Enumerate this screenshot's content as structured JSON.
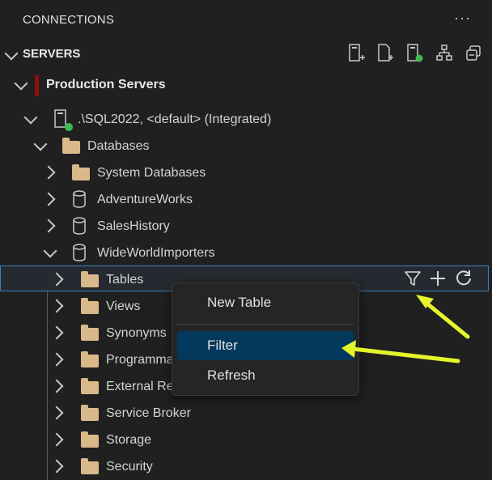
{
  "panel": {
    "title": "CONNECTIONS",
    "more_label": "···"
  },
  "servers_section": {
    "label": "SERVERS",
    "toolbar_icons": [
      "add-connection-icon",
      "new-query-icon",
      "server-connected-icon",
      "server-group-icon",
      "collapse-all-icon"
    ],
    "status_color": "#3fb950"
  },
  "tree": {
    "group": {
      "label": "Production Servers",
      "color": "#8b0f0f"
    },
    "server": {
      "label": ".\\SQL2022, <default> (Integrated)"
    },
    "databases": {
      "label": "Databases"
    },
    "items": [
      {
        "label": "System Databases"
      },
      {
        "label": "AdventureWorks"
      },
      {
        "label": "SalesHistory"
      },
      {
        "label": "WideWorldImporters"
      }
    ],
    "wwi_children": [
      {
        "label": "Tables"
      },
      {
        "label": "Views"
      },
      {
        "label": "Synonyms"
      },
      {
        "label": "Programmability"
      },
      {
        "label": "External Resources"
      },
      {
        "label": "Service Broker"
      },
      {
        "label": "Storage"
      },
      {
        "label": "Security"
      }
    ]
  },
  "context_menu": {
    "items": [
      {
        "label": "New Table"
      },
      {
        "label": "Filter"
      },
      {
        "label": "Refresh"
      }
    ]
  },
  "colors": {
    "accent": "#3d7fc4",
    "annotation_arrow": "#e6f52a",
    "menu_active": "#04395e"
  }
}
